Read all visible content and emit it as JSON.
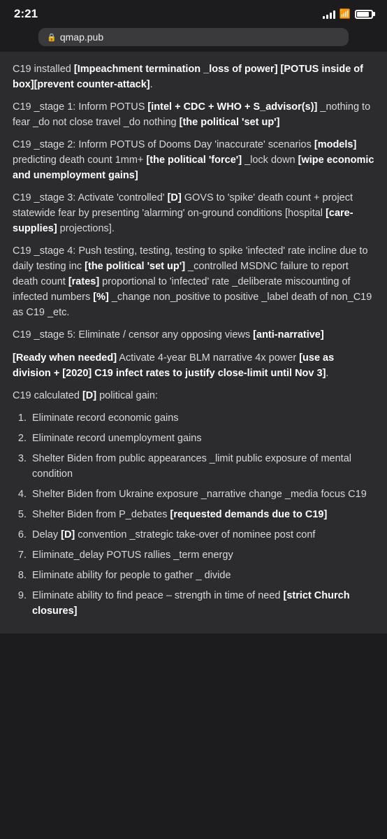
{
  "statusBar": {
    "time": "2:21",
    "url": "qmap.pub"
  },
  "content": {
    "paragraphs": [
      {
        "id": "p1",
        "text": "C19 installed [Impeachment termination _loss of power] [POTUS inside of box][prevent counter-attack]."
      },
      {
        "id": "p2",
        "text": "C19 _stage 1: Inform POTUS [intel + CDC + WHO + S_advisor(s)] _nothing to fear _do not close travel _do nothing [the political 'set up']"
      },
      {
        "id": "p3",
        "text": "C19 _stage 2: Inform POTUS of Dooms Day 'inaccurate' scenarios [models] predicting death count 1mm+ [the political 'force'] _lock down [wipe economic and unemployment gains]"
      },
      {
        "id": "p4",
        "text": "C19 _stage 3: Activate 'controlled' [D] GOVS to 'spike' death count + project statewide fear by presenting 'alarming' on-ground conditions [hospital [care-supplies] projections]."
      },
      {
        "id": "p5",
        "text": "C19 _stage 4: Push testing, testing, testing to spike 'infected' rate incline due to daily testing inc [the political 'set up'] _controlled MSDNC failure to report death count [rates] proportional to 'infected' rate _deliberate miscounting of infected numbers [%] _change non_positive to positive _label death of non_C19 as C19 _etc."
      },
      {
        "id": "p6",
        "text": "C19 _stage 5: Eliminate / censor any opposing views [anti-narrative]"
      },
      {
        "id": "p7",
        "text": "[Ready when needed] Activate 4-year BLM narrative 4x power [use as division + [2020] C19 infect rates to justify close-limit until Nov 3]."
      },
      {
        "id": "p8",
        "text": "C19 calculated [D] political gain:"
      }
    ],
    "listItems": [
      {
        "num": 1,
        "text": "Eliminate record economic gains"
      },
      {
        "num": 2,
        "text": "Eliminate record unemployment gains"
      },
      {
        "num": 3,
        "text": "Shelter Biden from public appearances _limit public exposure of mental condition"
      },
      {
        "num": 4,
        "text": "Shelter Biden from Ukraine exposure _narrative change _media focus C19"
      },
      {
        "num": 5,
        "text": "Shelter Biden from P_debates [requested demands due to C19]"
      },
      {
        "num": 6,
        "text": "Delay [D] convention _strategic take-over of nominee post conf"
      },
      {
        "num": 7,
        "text": "Eliminate_delay POTUS rallies _term energy"
      },
      {
        "num": 8,
        "text": "Eliminate ability for people to gather _ divide"
      },
      {
        "num": 9,
        "text": "Eliminate ability to find peace – strength in time of need [strict Church closures]"
      }
    ]
  }
}
